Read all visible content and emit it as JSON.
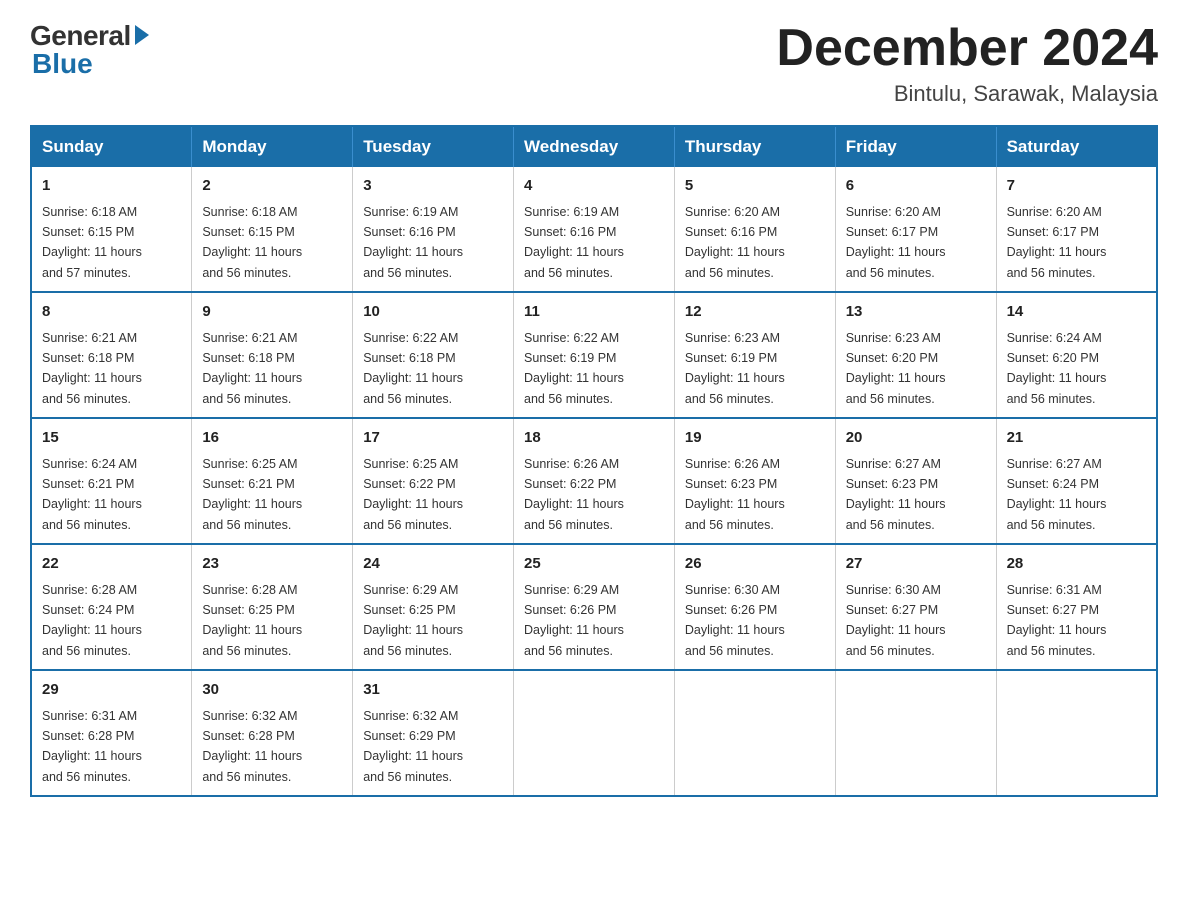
{
  "logo": {
    "general": "General",
    "blue": "Blue"
  },
  "title": "December 2024",
  "location": "Bintulu, Sarawak, Malaysia",
  "days_of_week": [
    "Sunday",
    "Monday",
    "Tuesday",
    "Wednesday",
    "Thursday",
    "Friday",
    "Saturday"
  ],
  "weeks": [
    [
      {
        "day": "1",
        "sunrise": "6:18 AM",
        "sunset": "6:15 PM",
        "daylight": "11 hours and 57 minutes."
      },
      {
        "day": "2",
        "sunrise": "6:18 AM",
        "sunset": "6:15 PM",
        "daylight": "11 hours and 56 minutes."
      },
      {
        "day": "3",
        "sunrise": "6:19 AM",
        "sunset": "6:16 PM",
        "daylight": "11 hours and 56 minutes."
      },
      {
        "day": "4",
        "sunrise": "6:19 AM",
        "sunset": "6:16 PM",
        "daylight": "11 hours and 56 minutes."
      },
      {
        "day": "5",
        "sunrise": "6:20 AM",
        "sunset": "6:16 PM",
        "daylight": "11 hours and 56 minutes."
      },
      {
        "day": "6",
        "sunrise": "6:20 AM",
        "sunset": "6:17 PM",
        "daylight": "11 hours and 56 minutes."
      },
      {
        "day": "7",
        "sunrise": "6:20 AM",
        "sunset": "6:17 PM",
        "daylight": "11 hours and 56 minutes."
      }
    ],
    [
      {
        "day": "8",
        "sunrise": "6:21 AM",
        "sunset": "6:18 PM",
        "daylight": "11 hours and 56 minutes."
      },
      {
        "day": "9",
        "sunrise": "6:21 AM",
        "sunset": "6:18 PM",
        "daylight": "11 hours and 56 minutes."
      },
      {
        "day": "10",
        "sunrise": "6:22 AM",
        "sunset": "6:18 PM",
        "daylight": "11 hours and 56 minutes."
      },
      {
        "day": "11",
        "sunrise": "6:22 AM",
        "sunset": "6:19 PM",
        "daylight": "11 hours and 56 minutes."
      },
      {
        "day": "12",
        "sunrise": "6:23 AM",
        "sunset": "6:19 PM",
        "daylight": "11 hours and 56 minutes."
      },
      {
        "day": "13",
        "sunrise": "6:23 AM",
        "sunset": "6:20 PM",
        "daylight": "11 hours and 56 minutes."
      },
      {
        "day": "14",
        "sunrise": "6:24 AM",
        "sunset": "6:20 PM",
        "daylight": "11 hours and 56 minutes."
      }
    ],
    [
      {
        "day": "15",
        "sunrise": "6:24 AM",
        "sunset": "6:21 PM",
        "daylight": "11 hours and 56 minutes."
      },
      {
        "day": "16",
        "sunrise": "6:25 AM",
        "sunset": "6:21 PM",
        "daylight": "11 hours and 56 minutes."
      },
      {
        "day": "17",
        "sunrise": "6:25 AM",
        "sunset": "6:22 PM",
        "daylight": "11 hours and 56 minutes."
      },
      {
        "day": "18",
        "sunrise": "6:26 AM",
        "sunset": "6:22 PM",
        "daylight": "11 hours and 56 minutes."
      },
      {
        "day": "19",
        "sunrise": "6:26 AM",
        "sunset": "6:23 PM",
        "daylight": "11 hours and 56 minutes."
      },
      {
        "day": "20",
        "sunrise": "6:27 AM",
        "sunset": "6:23 PM",
        "daylight": "11 hours and 56 minutes."
      },
      {
        "day": "21",
        "sunrise": "6:27 AM",
        "sunset": "6:24 PM",
        "daylight": "11 hours and 56 minutes."
      }
    ],
    [
      {
        "day": "22",
        "sunrise": "6:28 AM",
        "sunset": "6:24 PM",
        "daylight": "11 hours and 56 minutes."
      },
      {
        "day": "23",
        "sunrise": "6:28 AM",
        "sunset": "6:25 PM",
        "daylight": "11 hours and 56 minutes."
      },
      {
        "day": "24",
        "sunrise": "6:29 AM",
        "sunset": "6:25 PM",
        "daylight": "11 hours and 56 minutes."
      },
      {
        "day": "25",
        "sunrise": "6:29 AM",
        "sunset": "6:26 PM",
        "daylight": "11 hours and 56 minutes."
      },
      {
        "day": "26",
        "sunrise": "6:30 AM",
        "sunset": "6:26 PM",
        "daylight": "11 hours and 56 minutes."
      },
      {
        "day": "27",
        "sunrise": "6:30 AM",
        "sunset": "6:27 PM",
        "daylight": "11 hours and 56 minutes."
      },
      {
        "day": "28",
        "sunrise": "6:31 AM",
        "sunset": "6:27 PM",
        "daylight": "11 hours and 56 minutes."
      }
    ],
    [
      {
        "day": "29",
        "sunrise": "6:31 AM",
        "sunset": "6:28 PM",
        "daylight": "11 hours and 56 minutes."
      },
      {
        "day": "30",
        "sunrise": "6:32 AM",
        "sunset": "6:28 PM",
        "daylight": "11 hours and 56 minutes."
      },
      {
        "day": "31",
        "sunrise": "6:32 AM",
        "sunset": "6:29 PM",
        "daylight": "11 hours and 56 minutes."
      },
      null,
      null,
      null,
      null
    ]
  ],
  "labels": {
    "sunrise": "Sunrise:",
    "sunset": "Sunset:",
    "daylight": "Daylight:"
  }
}
